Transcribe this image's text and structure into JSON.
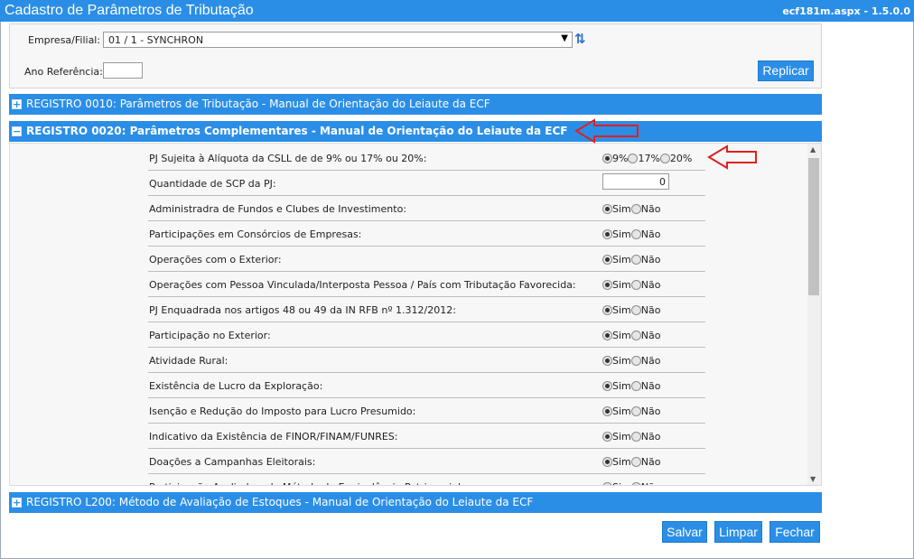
{
  "window": {
    "title": "Cadastro de Parâmetros de Tributação",
    "version": "ecf181m.aspx - 1.5.0.0"
  },
  "filters": {
    "empresa_label": "Empresa/Filial:",
    "empresa_value": "01 / 1 - SYNCHRON",
    "ano_label": "Ano Referência:",
    "ano_value": "",
    "replicar_label": "Replicar"
  },
  "sections": {
    "s0010": {
      "toggle": "+",
      "title": "REGISTRO 0010: Parâmetros de Tributação - Manual de Orientação do Leiaute da ECF"
    },
    "s0020": {
      "toggle": "−",
      "title": "REGISTRO 0020: Parâmetros Complementares - Manual de Orientação do Leiaute da ECF"
    },
    "sL200": {
      "toggle": "+",
      "title": "REGISTRO L200: Método de Avaliação de Estoques - Manual de Orientação do Leiaute da ECF"
    }
  },
  "params": {
    "aliquota": {
      "label": "PJ Sujeita à Alíquota da CSLL de de 9% ou 17% ou 20%:",
      "options": [
        "9%",
        "17%",
        "20%"
      ],
      "selected": "9%"
    },
    "qtd_scp": {
      "label": "Quantidade de SCP da PJ:",
      "value": "0"
    },
    "yes_label": "Sim",
    "no_label": "Não",
    "questions": [
      {
        "label": "Administradra de Fundos e Clubes de Investimento:",
        "selected": "Sim"
      },
      {
        "label": "Participações em Consórcios de Empresas:",
        "selected": "Sim"
      },
      {
        "label": "Operações com o Exterior:",
        "selected": "Sim"
      },
      {
        "label": "Operações com Pessoa Vinculada/Interposta Pessoa / País com Tributação Favorecida:",
        "selected": "Sim"
      },
      {
        "label": "PJ Enquadrada nos artigos 48 ou 49 da IN RFB nº 1.312/2012:",
        "selected": "Sim"
      },
      {
        "label": "Participação no Exterior:",
        "selected": "Sim"
      },
      {
        "label": "Atividade Rural:",
        "selected": "Sim"
      },
      {
        "label": "Existência de Lucro da Exploração:",
        "selected": "Sim"
      },
      {
        "label": "Isenção e Redução do Imposto para Lucro Presumido:",
        "selected": "Sim"
      },
      {
        "label": "Indicativo da Existência de FINOR/FINAM/FUNRES:",
        "selected": "Sim"
      },
      {
        "label": "Doações a Campanhas Eleitorais:",
        "selected": "Sim"
      },
      {
        "label": "Participação Avaliada pelo Método de Equivalência Patrimonial:",
        "selected": "Sim"
      }
    ]
  },
  "actions": {
    "salvar": "Salvar",
    "limpar": "Limpar",
    "fechar": "Fechar"
  },
  "colors": {
    "accent": "#2b8ee6",
    "annotation": "#e02020"
  }
}
